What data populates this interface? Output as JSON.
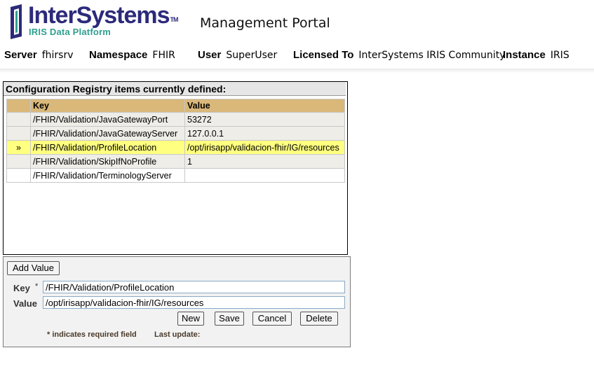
{
  "header": {
    "logo_word": "InterSystems",
    "logo_tm": "TM",
    "logo_sub": "IRIS Data Platform",
    "portal_title": "Management Portal"
  },
  "info": {
    "server_label": "Server",
    "server": "fhirsrv",
    "namespace_label": "Namespace",
    "namespace": "FHIR",
    "user_label": "User",
    "user": "SuperUser",
    "licensed_label": "Licensed To",
    "licensed": "InterSystems IRIS Community",
    "instance_label": "Instance",
    "instance": "IRIS"
  },
  "registry": {
    "title": "Configuration Registry items currently defined:",
    "columns": [
      "",
      "Key",
      "Value"
    ],
    "selected_marker": "»",
    "rows": [
      {
        "key": "/FHIR/Validation/JavaGatewayPort",
        "value": "53272"
      },
      {
        "key": "/FHIR/Validation/JavaGatewayServer",
        "value": "127.0.0.1"
      },
      {
        "key": "/FHIR/Validation/ProfileLocation",
        "value": "/opt/irisapp/validacion-fhir/IG/resources"
      },
      {
        "key": "/FHIR/Validation/SkipIfNoProfile",
        "value": "1"
      },
      {
        "key": "/FHIR/Validation/TerminologyServer",
        "value": ""
      }
    ]
  },
  "editor": {
    "add_value_label": "Add Value",
    "key_label": "Key",
    "value_label": "Value",
    "required_mark": "*",
    "key_value": "/FHIR/Validation/ProfileLocation",
    "value_value": "/opt/irisapp/validacion-fhir/IG/resources",
    "new_label": "New",
    "save_label": "Save",
    "cancel_label": "Cancel",
    "delete_label": "Delete",
    "required_note": "* indicates required field",
    "last_update_label": "Last update:"
  },
  "colors": {
    "brand_text": "#2c2a7a",
    "brand_sub": "#2f9f8f",
    "header_row": "#d9b87a",
    "selected_row": "#ffff80"
  }
}
